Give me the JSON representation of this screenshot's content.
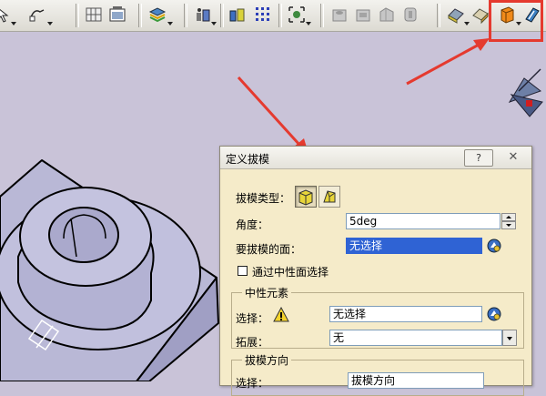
{
  "dialog": {
    "title": "定义拔模",
    "help_label": "?",
    "close_label": "✕",
    "draft_type_label": "拔模类型：",
    "angle_label": "角度：",
    "angle_value": "5deg",
    "faces_label": "要拔模的面：",
    "faces_value": "无选择",
    "neutral_checkbox_label": "通过中性面选择",
    "neutral_group_title": "中性元素",
    "selection_label": "选择：",
    "selection_value": "无选择",
    "propagation_label": "拓展：",
    "propagation_value": "无",
    "direction_group_title": "拔模方向",
    "direction_selection_label": "选择：",
    "direction_selection_value": "拔模方向"
  },
  "colors": {
    "accent_red": "#e53a2f",
    "dialog_bg": "#f5ebc9",
    "selected_field": "#2f63d4",
    "model_fill": "#b9b8d6",
    "viewport_bg": "#c9c3d8"
  },
  "toolbar": {
    "icons": [
      "select-arrow-icon",
      "sketch-icon",
      "grid-snap-icon",
      "view-panel-icon",
      "layer-stack-icon",
      "sensor-icon",
      "parts-icon",
      "grid-dots-icon",
      "fit-all-icon",
      "hole-icon",
      "pocket-icon",
      "rib-icon",
      "slot-icon",
      "fillet-icon",
      "chamfer-icon",
      "draft-angle-icon",
      "shell-icon"
    ],
    "highlighted_icon": "draft-angle-icon"
  }
}
